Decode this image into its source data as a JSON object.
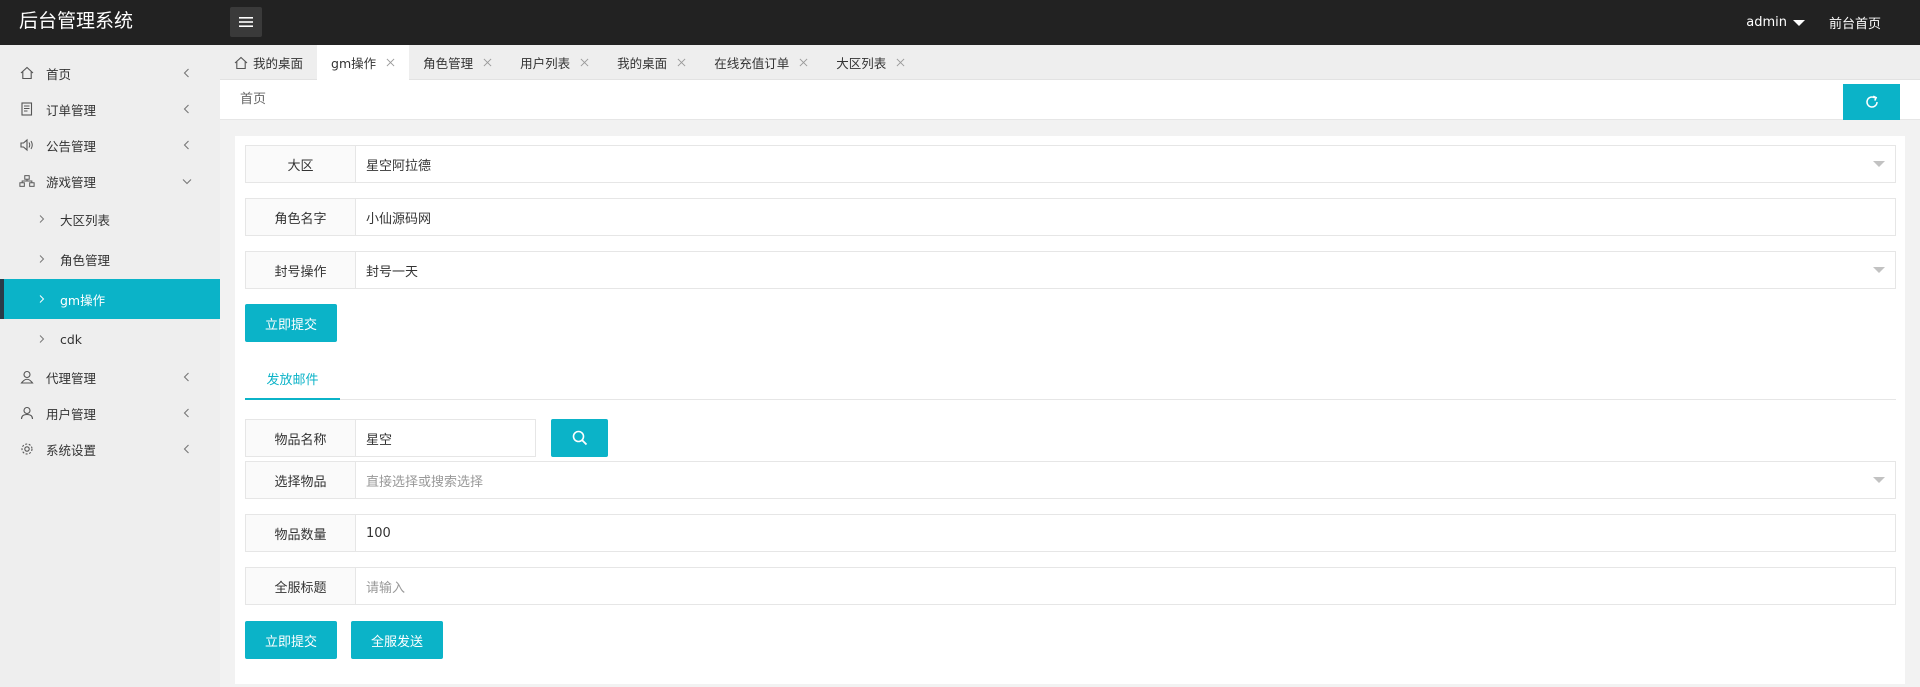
{
  "app": {
    "title": "后台管理系统"
  },
  "header": {
    "user": "admin",
    "front_link": "前台首页"
  },
  "sidebar": {
    "items": [
      {
        "label": "首页",
        "icon": "home-icon"
      },
      {
        "label": "订单管理",
        "icon": "order-icon"
      },
      {
        "label": "公告管理",
        "icon": "speaker-icon"
      },
      {
        "label": "游戏管理",
        "icon": "sitemap-icon"
      },
      {
        "label": "代理管理",
        "icon": "agent-icon"
      },
      {
        "label": "用户管理",
        "icon": "user-icon"
      },
      {
        "label": "系统设置",
        "icon": "gear-icon"
      }
    ],
    "game_sub": [
      {
        "label": "大区列表"
      },
      {
        "label": "角色管理"
      },
      {
        "label": "gm操作"
      },
      {
        "label": "cdk"
      }
    ]
  },
  "tabs": [
    {
      "label": "我的桌面"
    },
    {
      "label": "gm操作"
    },
    {
      "label": "角色管理"
    },
    {
      "label": "用户列表"
    },
    {
      "label": "我的桌面"
    },
    {
      "label": "在线充值订单"
    },
    {
      "label": "大区列表"
    }
  ],
  "breadcrumb": "首页",
  "form1": {
    "zone_label": "大区",
    "zone_value": "星空阿拉德",
    "role_label": "角色名字",
    "role_value": "小仙源码网",
    "ban_label": "封号操作",
    "ban_value": "封号一天",
    "submit": "立即提交"
  },
  "mail_tab": "发放邮件",
  "form2": {
    "item_name_label": "物品名称",
    "item_name_value": "星空",
    "select_label": "选择物品",
    "select_placeholder": "直接选择或搜索选择",
    "qty_label": "物品数量",
    "qty_value": "100",
    "title_label": "全服标题",
    "title_placeholder": "请输入",
    "submit": "立即提交",
    "broadcast": "全服发送"
  },
  "colors": {
    "accent": "#0bb3c8",
    "topbar": "#222222",
    "sidebar": "#eeeeee"
  }
}
